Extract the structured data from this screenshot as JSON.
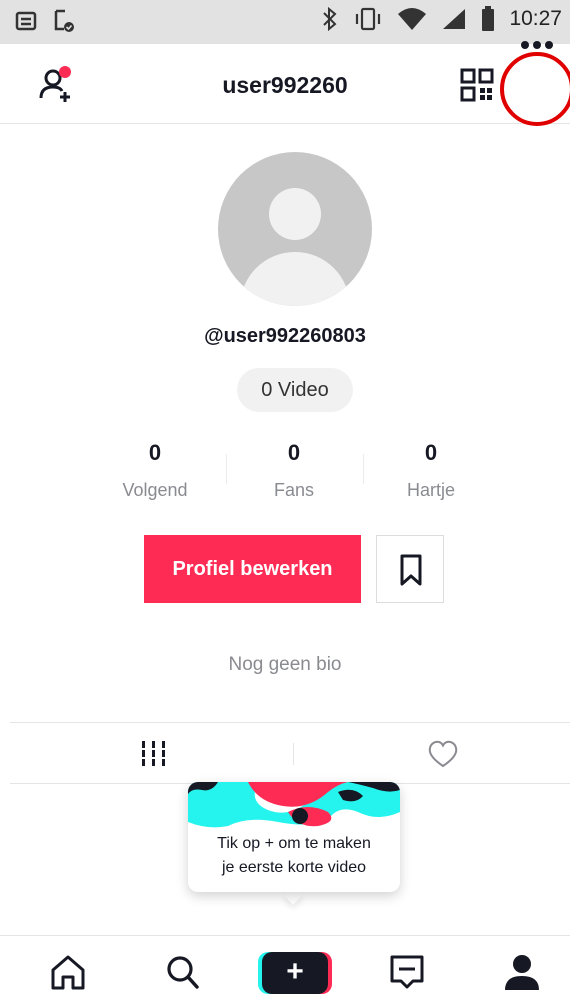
{
  "status_bar": {
    "time": "10:27",
    "icons": [
      "notes-icon",
      "doc-check-icon",
      "bluetooth-icon",
      "vibrate-icon",
      "wifi-icon",
      "signal-icon",
      "battery-icon"
    ]
  },
  "header": {
    "title": "user992260",
    "icons": [
      "add-friend-icon",
      "qr-code-icon",
      "more-options-icon"
    ]
  },
  "profile": {
    "handle": "@user992260803",
    "video_count": "0 Video",
    "bio": "Nog geen bio"
  },
  "stats": [
    {
      "value": "0",
      "label": "Volgend"
    },
    {
      "value": "0",
      "label": "Fans"
    },
    {
      "value": "0",
      "label": "Hartje"
    }
  ],
  "actions": {
    "edit_profile": "Profiel bewerken"
  },
  "tooltip": {
    "line1": "Tik op + om te maken",
    "line2": "je eerste korte video"
  },
  "bottom_nav": {
    "create_symbol": "+"
  },
  "colors": {
    "accent": "#fe2c55",
    "highlight_circle": "#e00000",
    "cyan": "#25f4ee",
    "dark": "#161823"
  }
}
